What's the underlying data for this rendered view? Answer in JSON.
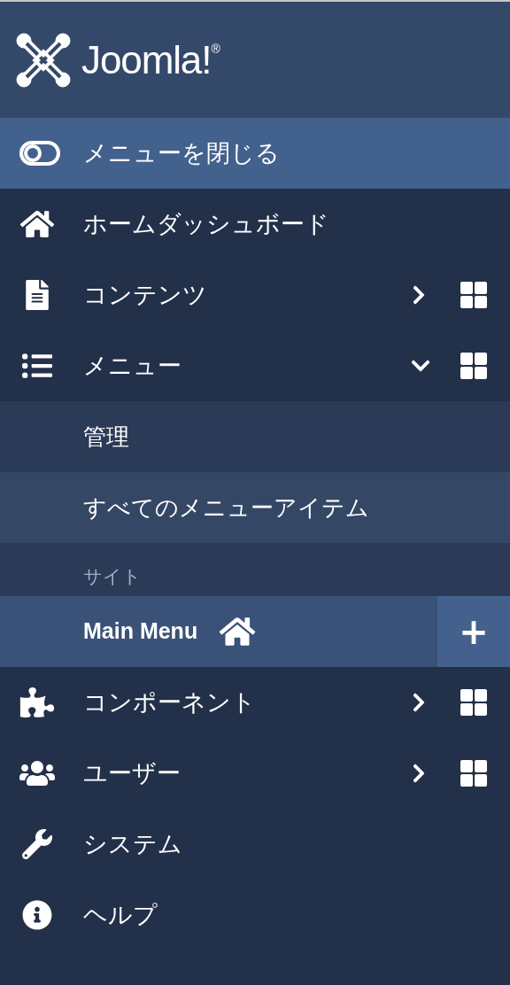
{
  "brand": {
    "name": "Joomla!$^{®}$"
  },
  "toggle": {
    "label": "メニューを閉じる"
  },
  "items": [
    {
      "label": "ホームダッシュボード",
      "expandable": false,
      "dashboard": false
    },
    {
      "label": "コンテンツ",
      "expandable": true,
      "expanded": false,
      "dashboard": true
    },
    {
      "label": "メニュー",
      "expandable": true,
      "expanded": true,
      "dashboard": true,
      "children": [
        {
          "kind": "link",
          "label": "管理",
          "selected": false,
          "hovered": false,
          "home": false
        },
        {
          "kind": "link",
          "label": "すべてのメニューアイテム",
          "selected": false,
          "hovered": true,
          "home": false
        },
        {
          "kind": "heading",
          "label": "サイト"
        },
        {
          "kind": "link",
          "label": "Main Menu",
          "selected": true,
          "hovered": false,
          "home": true,
          "add": "+"
        }
      ]
    },
    {
      "label": "コンポーネント",
      "expandable": true,
      "expanded": false,
      "dashboard": true
    },
    {
      "label": "ユーザー",
      "expandable": true,
      "expanded": false,
      "dashboard": true
    },
    {
      "label": "システム",
      "expandable": false,
      "dashboard": false
    },
    {
      "label": "ヘルプ",
      "expandable": false,
      "dashboard": false
    }
  ]
}
